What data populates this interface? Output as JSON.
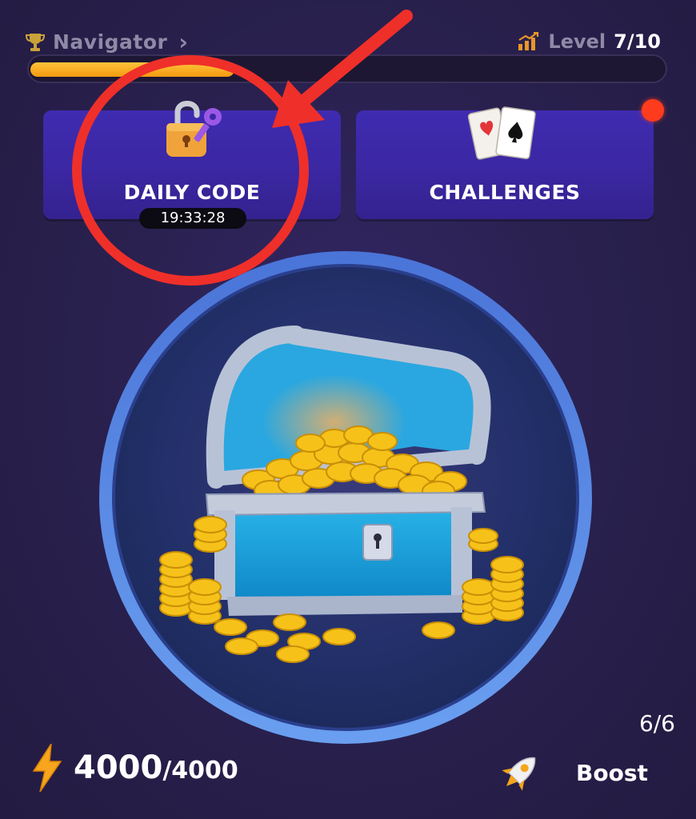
{
  "header": {
    "title": "Navigator",
    "level_label": "Level",
    "level_value": "7/10"
  },
  "progress": {
    "fraction": 0.32,
    "fill_color": "#f5a614"
  },
  "cards": {
    "daily_code": {
      "label": "DAILY CODE",
      "timer": "19:33:28",
      "icon": "padlock-with-key-icon"
    },
    "challenges": {
      "label": "CHALLENGES",
      "icon": "playing-cards-icon",
      "has_notification": true
    }
  },
  "tap_area": {
    "icon": "treasure-chest-icon",
    "counter": "6/6"
  },
  "energy": {
    "current": "4000",
    "max": "/4000",
    "icon": "lightning-bolt-icon"
  },
  "boost": {
    "label": "Boost",
    "icon": "rocket-icon"
  },
  "colors": {
    "background": "#2a2049",
    "card": "#3b28a4",
    "accent_orange": "#f5a614",
    "annotation_red": "#ef2f2a",
    "notification": "#ff3b1d"
  }
}
